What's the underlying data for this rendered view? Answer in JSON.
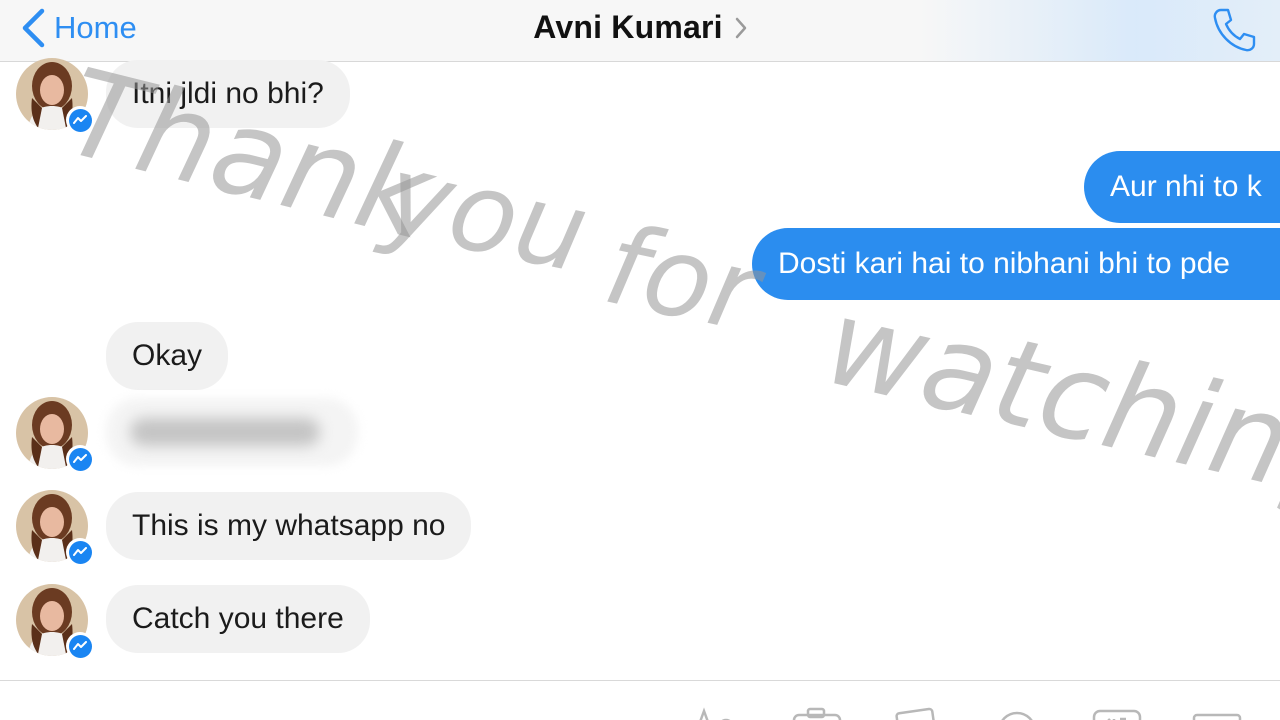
{
  "header": {
    "back_label": "Home",
    "contact_name": "Avni Kumari"
  },
  "messages": [
    {
      "side": "incoming",
      "text": "Itni jldi no bhi?",
      "avatar": true
    },
    {
      "side": "outgoing",
      "text": "Aur nhi to k"
    },
    {
      "side": "outgoing",
      "text": "Dosti kari hai to nibhani bhi to pde"
    },
    {
      "side": "incoming",
      "text": "Okay",
      "avatar": false
    },
    {
      "side": "incoming",
      "text": "",
      "blurred": true,
      "avatar": true
    },
    {
      "side": "incoming",
      "text": "This is my whatsapp no",
      "avatar": true
    },
    {
      "side": "incoming",
      "text": "Catch you there",
      "avatar": true
    }
  ],
  "watermark": {
    "words": [
      "Thank",
      "you",
      "for",
      "watching"
    ]
  },
  "colors": {
    "accent": "#2e8ef2",
    "outgoing_bubble": "#2b8def",
    "incoming_bubble": "#f1f1f1",
    "header_bg": "#f7f7f7"
  },
  "icons": [
    "chevron-left-icon",
    "chevron-right-icon",
    "phone-icon",
    "messenger-badge-icon",
    "text-format-icon",
    "camera-icon",
    "photo-icon",
    "emoji-icon",
    "gif-icon",
    "more-icon"
  ]
}
